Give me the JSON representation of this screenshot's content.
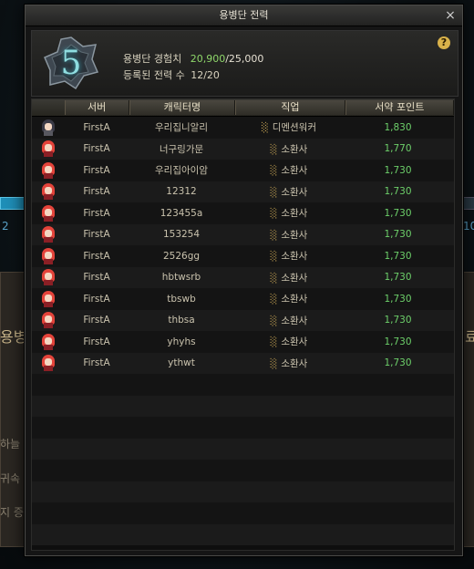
{
  "window": {
    "title": "용병단 전력",
    "close_label": "×"
  },
  "header": {
    "level": "5",
    "exp_label": "용병단 경험치",
    "exp_current": "20,900",
    "exp_max": "/25,000",
    "registered_label": "등록된 전력 수",
    "registered_value": "12/20",
    "help_label": "?"
  },
  "table": {
    "columns": [
      "",
      "서버",
      "캐릭터명",
      "직업",
      "서약 포인트"
    ],
    "rows": [
      {
        "server": "FirstA",
        "name": "우리집니알리",
        "job": "디멘션워커",
        "points": "1,830",
        "avatar": "dark"
      },
      {
        "server": "FirstA",
        "name": "너구링가문",
        "job": "소환사",
        "points": "1,770",
        "avatar": "red"
      },
      {
        "server": "FirstA",
        "name": "우리집아이암",
        "job": "소환사",
        "points": "1,730",
        "avatar": "red"
      },
      {
        "server": "FirstA",
        "name": "12312",
        "job": "소환사",
        "points": "1,730",
        "avatar": "red"
      },
      {
        "server": "FirstA",
        "name": "123455a",
        "job": "소환사",
        "points": "1,730",
        "avatar": "red"
      },
      {
        "server": "FirstA",
        "name": "153254",
        "job": "소환사",
        "points": "1,730",
        "avatar": "red"
      },
      {
        "server": "FirstA",
        "name": "2526gg",
        "job": "소환사",
        "points": "1,730",
        "avatar": "red"
      },
      {
        "server": "FirstA",
        "name": "hbtwsrb",
        "job": "소환사",
        "points": "1,730",
        "avatar": "red"
      },
      {
        "server": "FirstA",
        "name": "tbswb",
        "job": "소환사",
        "points": "1,730",
        "avatar": "red"
      },
      {
        "server": "FirstA",
        "name": "thbsa",
        "job": "소환사",
        "points": "1,730",
        "avatar": "red"
      },
      {
        "server": "FirstA",
        "name": "yhyhs",
        "job": "소환사",
        "points": "1,730",
        "avatar": "red"
      },
      {
        "server": "FirstA",
        "name": "ythwt",
        "job": "소환사",
        "points": "1,730",
        "avatar": "red"
      }
    ],
    "empty_rows": 8,
    "job_icon": "job-emblem-icon"
  },
  "background": {
    "left_number": "2",
    "right_number": "10",
    "left_heading": "용병",
    "right_heading": "료",
    "left_line1": "하늘 B",
    "left_line2": "귀속 ",
    "left_line3": "지 증가"
  },
  "colors": {
    "points": "#6dd06a",
    "exp_current": "#8fd76a",
    "emblem": "#8fdde0"
  }
}
